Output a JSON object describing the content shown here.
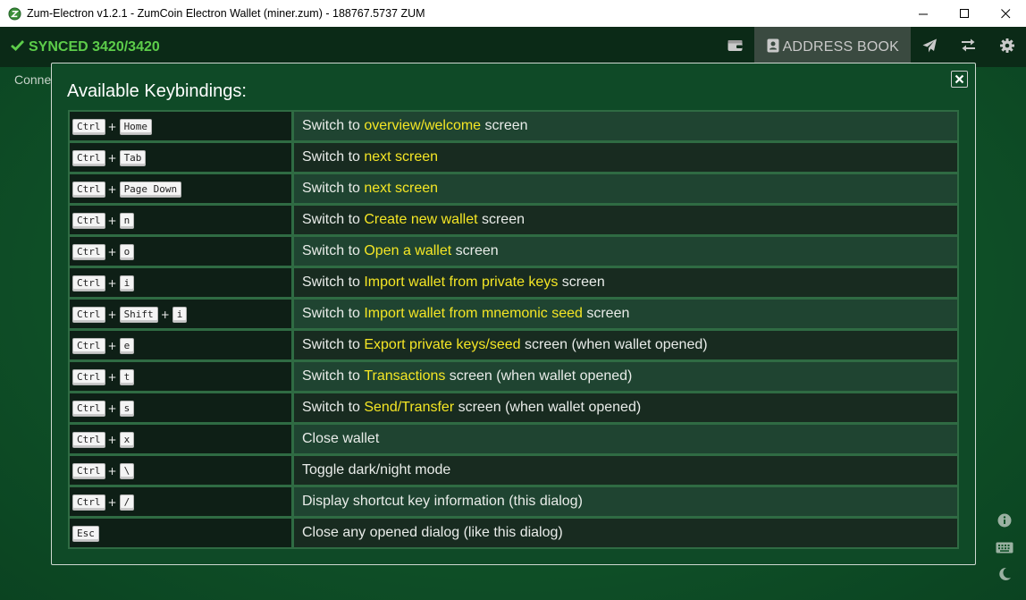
{
  "window": {
    "title": "Zum-Electron v1.2.1 - ZumCoin Electron Wallet (miner.zum) - 188767.5737 ZUM",
    "controls": [
      "minimize-icon",
      "maximize-icon",
      "close-icon"
    ]
  },
  "header": {
    "sync_status": "SYNCED 3420/3420",
    "nav": {
      "wallet_icon": "wallet-icon",
      "address_book_label": "ADDRESS BOOK",
      "send_icon": "send-icon",
      "transactions_icon": "transfer-icon",
      "settings_icon": "gear-icon"
    }
  },
  "background": {
    "connection_text": "Conne"
  },
  "modal": {
    "title": "Available Keybindings:",
    "rows": [
      {
        "keys": [
          "Ctrl",
          "Home"
        ],
        "pre": "Switch to ",
        "hl": "overview/welcome",
        "post": " screen"
      },
      {
        "keys": [
          "Ctrl",
          "Tab"
        ],
        "pre": "Switch to ",
        "hl": "next screen",
        "post": ""
      },
      {
        "keys": [
          "Ctrl",
          "Page Down"
        ],
        "pre": "Switch to ",
        "hl": "next screen",
        "post": ""
      },
      {
        "keys": [
          "Ctrl",
          "n"
        ],
        "pre": "Switch to ",
        "hl": "Create new wallet",
        "post": " screen"
      },
      {
        "keys": [
          "Ctrl",
          "o"
        ],
        "pre": "Switch to ",
        "hl": "Open a wallet",
        "post": " screen"
      },
      {
        "keys": [
          "Ctrl",
          "i"
        ],
        "pre": "Switch to ",
        "hl": "Import wallet from private keys",
        "post": " screen"
      },
      {
        "keys": [
          "Ctrl",
          "Shift",
          "i"
        ],
        "pre": "Switch to ",
        "hl": "Import wallet from mnemonic seed",
        "post": " screen"
      },
      {
        "keys": [
          "Ctrl",
          "e"
        ],
        "pre": "Switch to ",
        "hl": "Export private keys/seed",
        "post": " screen (when wallet opened)"
      },
      {
        "keys": [
          "Ctrl",
          "t"
        ],
        "pre": "Switch to ",
        "hl": "Transactions",
        "post": " screen (when wallet opened)"
      },
      {
        "keys": [
          "Ctrl",
          "s"
        ],
        "pre": "Switch to ",
        "hl": "Send/Transfer",
        "post": " screen (when wallet opened)"
      },
      {
        "keys": [
          "Ctrl",
          "x"
        ],
        "pre": "Close wallet",
        "hl": "",
        "post": ""
      },
      {
        "keys": [
          "Ctrl",
          "\\"
        ],
        "pre": "Toggle dark/night mode",
        "hl": "",
        "post": ""
      },
      {
        "keys": [
          "Ctrl",
          "/"
        ],
        "pre": "Display shortcut key information (this dialog)",
        "hl": "",
        "post": ""
      },
      {
        "keys": [
          "Esc"
        ],
        "pre": "Close any opened dialog (like this dialog)",
        "hl": "",
        "post": ""
      }
    ]
  },
  "colors": {
    "accent_green": "#5dcd4a",
    "highlight_yellow": "#f5e625",
    "header_bg": "#0b2a17",
    "modal_bg": "#0f4a27"
  }
}
